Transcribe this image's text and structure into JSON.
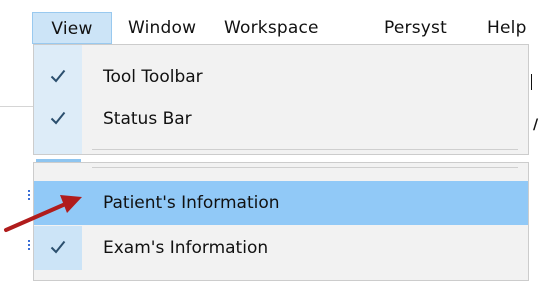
{
  "menubar": {
    "items": [
      {
        "label": "View",
        "active": true
      },
      {
        "label": "Window",
        "active": false
      },
      {
        "label": "Workspace",
        "active": false
      },
      {
        "label": "Persyst",
        "active": false
      },
      {
        "label": "Help",
        "active": false
      }
    ]
  },
  "view_menu": {
    "top_section": [
      {
        "label": "Tool Toolbar",
        "checked": true
      },
      {
        "label": "Status Bar",
        "checked": true
      }
    ],
    "bottom_section": [
      {
        "label": "Patient's Information",
        "checked": false,
        "highlighted": true
      },
      {
        "label": "Exam's Information",
        "checked": true,
        "highlighted": false
      }
    ]
  },
  "annotation": {
    "icon": "red-arrow-icon",
    "color": "#b01c1c"
  },
  "colors": {
    "menu_active_bg": "#cce4f7",
    "item_highlight_bg": "#91c9f7",
    "check_color": "#2b4f6e",
    "menu_bg": "#f2f2f2"
  }
}
